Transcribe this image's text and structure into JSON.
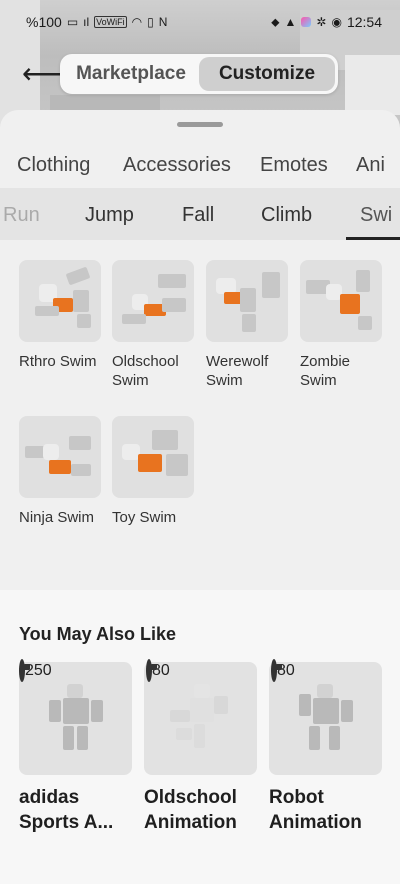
{
  "status_bar": {
    "battery": "%100",
    "signal": "ıl",
    "wifi_label": "VoWiFi",
    "icons_left": [
      "battery-icon",
      "signal-icon",
      "vowifi-icon",
      "wifi-icon",
      "vibrate-icon",
      "nfc-icon"
    ],
    "icons_right": [
      "location-icon",
      "bell-icon",
      "app-icon",
      "settings-icon",
      "eye-icon"
    ],
    "time": "12:54"
  },
  "header": {
    "segments": [
      "Marketplace",
      "Customize"
    ],
    "active_segment": "Customize"
  },
  "categories": [
    "Clothing",
    "Accessories",
    "Emotes",
    "Ani"
  ],
  "sub_tabs": [
    "Run",
    "Jump",
    "Fall",
    "Climb",
    "Swi"
  ],
  "active_sub_tab": "Swi",
  "items": [
    {
      "name": "Rthro Swim"
    },
    {
      "name": "Oldschool Swim"
    },
    {
      "name": "Werewolf Swim"
    },
    {
      "name": "Zombie Swim"
    },
    {
      "name": "Ninja Swim"
    },
    {
      "name": "Toy Swim"
    }
  ],
  "recommendations": {
    "title": "You May Also Like",
    "cards": [
      {
        "title": "adidas Sports A...",
        "price": "250"
      },
      {
        "title": "Oldschool Animation",
        "price": "80"
      },
      {
        "title": "Robot Animation",
        "price": "80"
      }
    ]
  },
  "colors": {
    "accent_orange": "#e8731f",
    "sheet_bg": "#f0f0f0",
    "segment_active": "#cfcfcf"
  }
}
